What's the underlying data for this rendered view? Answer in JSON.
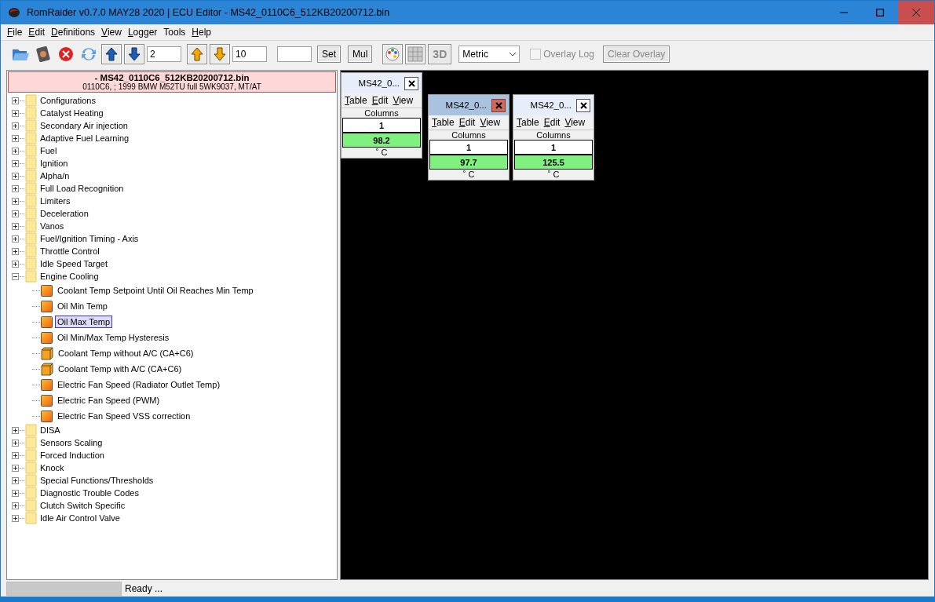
{
  "window": {
    "title": "RomRaider v0.7.0 MAY28 2020 | ECU Editor - MS42_0110C6_512KB20200712.bin"
  },
  "menu": [
    {
      "label": "File",
      "mnemonic": true
    },
    {
      "label": "Edit",
      "mnemonic": true
    },
    {
      "label": "Definitions",
      "mnemonic": true
    },
    {
      "label": "View",
      "mnemonic": true
    },
    {
      "label": "Logger",
      "mnemonic": true
    },
    {
      "label": "Tools",
      "mnemonic": false
    },
    {
      "label": "Help",
      "mnemonic": true
    }
  ],
  "toolbar": {
    "coarse_value": "2",
    "fine_value": "10",
    "set_label": "Set",
    "mul_label": "Mul",
    "three_d_label": "3D",
    "units": "Metric",
    "overlay_log": {
      "label": "Overlay Log",
      "checked": false,
      "disabled": true
    },
    "clear_overlay": {
      "label": "Clear Overlay",
      "disabled": true
    }
  },
  "rom": {
    "title": "- MS42_0110C6_512KB20200712.bin",
    "subtitle": "0110C6, ; 1999 BMW M52TU full 5WK9037, MT/AT"
  },
  "tree": [
    {
      "label": "Configurations",
      "expanded": false
    },
    {
      "label": "Catalyst Heating",
      "expanded": false
    },
    {
      "label": "Secondary Air injection",
      "expanded": false
    },
    {
      "label": "Adaptive Fuel Learning",
      "expanded": false
    },
    {
      "label": "Fuel",
      "expanded": false
    },
    {
      "label": "Ignition",
      "expanded": false
    },
    {
      "label": "Alpha/n",
      "expanded": false
    },
    {
      "label": "Full Load Recognition",
      "expanded": false
    },
    {
      "label": "Limiters",
      "expanded": false
    },
    {
      "label": "Deceleration",
      "expanded": false
    },
    {
      "label": "Vanos",
      "expanded": false
    },
    {
      "label": "Fuel/Ignition Timing - Axis",
      "expanded": false
    },
    {
      "label": "Throttle Control",
      "expanded": false
    },
    {
      "label": "Idle Speed Target",
      "expanded": false
    },
    {
      "label": "Engine Cooling",
      "expanded": true,
      "children": [
        {
          "label": "Coolant Temp Setpoint Until Oil Reaches Min Temp",
          "kind": "scalar",
          "selected": false
        },
        {
          "label": "Oil Min Temp",
          "kind": "scalar",
          "selected": false
        },
        {
          "label": "Oil Max Temp",
          "kind": "scalar",
          "selected": true
        },
        {
          "label": "Oil Min/Max Temp Hysteresis",
          "kind": "scalar",
          "selected": false
        },
        {
          "label": "Coolant Temp without A/C (CA+C6)",
          "kind": "table",
          "selected": false
        },
        {
          "label": "Coolant Temp with A/C (CA+C6)",
          "kind": "table",
          "selected": false
        },
        {
          "label": "Electric Fan Speed (Radiator Outlet Temp)",
          "kind": "scalar",
          "selected": false
        },
        {
          "label": "Electric Fan Speed (PWM)",
          "kind": "scalar",
          "selected": false
        },
        {
          "label": "Electric Fan Speed VSS correction",
          "kind": "scalar",
          "selected": false
        }
      ]
    },
    {
      "label": "DISA",
      "expanded": false
    },
    {
      "label": "Sensors Scaling",
      "expanded": false
    },
    {
      "label": "Forced Induction",
      "expanded": false
    },
    {
      "label": "Knock",
      "expanded": false
    },
    {
      "label": "Special Functions/Thresholds",
      "expanded": false
    },
    {
      "label": "Diagnostic Trouble Codes",
      "expanded": false
    },
    {
      "label": "Clutch Switch Specific",
      "expanded": false
    },
    {
      "label": "Idle Air Control Valve",
      "expanded": false
    }
  ],
  "table_windows": [
    {
      "title": "MS42_0...",
      "active": false,
      "menus": [
        "Table",
        "Edit",
        "View"
      ],
      "header": "Columns",
      "column": "1",
      "value": "98.2",
      "unit": "˚ C"
    },
    {
      "title": "MS42_0...",
      "active": true,
      "menus": [
        "Table",
        "Edit",
        "View"
      ],
      "header": "Columns",
      "column": "1",
      "value": "97.7",
      "unit": "˚ C"
    },
    {
      "title": "MS42_0...",
      "active": false,
      "menus": [
        "Table",
        "Edit",
        "View"
      ],
      "header": "Columns",
      "column": "1",
      "value": "125.5",
      "unit": "˚ C"
    }
  ],
  "status_bar": {
    "level": 0,
    "text": "Ready ..."
  }
}
